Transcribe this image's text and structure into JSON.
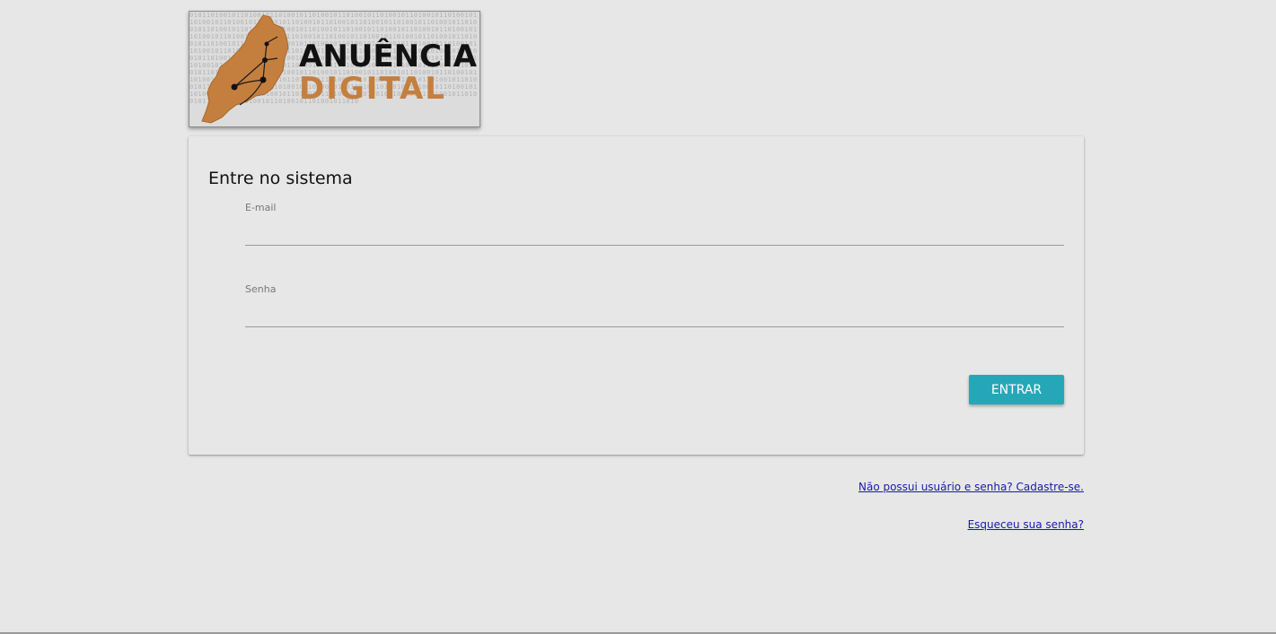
{
  "logo": {
    "word_top": "ANUÊNCIA",
    "word_bottom": "DIGITAL",
    "accent_color": "#c47f3f",
    "binary_pattern": "0101101001011010010110100101101001011010010110100101101001011010010110100101101001011010010110100101101001011010010110100101101001011010010110100101101001011010010110100101101001011010010110100101101001011010010110100101101001011010010110100101101001011010010110100101101001011010010110100101101001011010010110100101101001011010010110100101101001011010010110100101101001011010010110100101101001011010010110100101101001011010010110100101101001011010010110100101101001011010010110100101101001011010010110100101101001011010010110100101101001011010010110100101101001011010010110100101101001011010010110100101101001011010010110100101101001011010010110100101101001011010010110100101101001011010010110100101101001011010010110100101101001011010010110100101101001011010010110100101101001011010010110100101101001011010010110100101101001011010010110100101101001011010"
  },
  "login": {
    "title": "Entre no sistema",
    "email_label": "E-mail",
    "email_value": "",
    "password_label": "Senha",
    "password_value": "",
    "submit_label": "ENTRAR",
    "submit_color": "#26a7b8"
  },
  "links": {
    "register": "Não possui usuário e senha? Cadastre-se.",
    "forgot": "Esqueceu sua senha?"
  }
}
